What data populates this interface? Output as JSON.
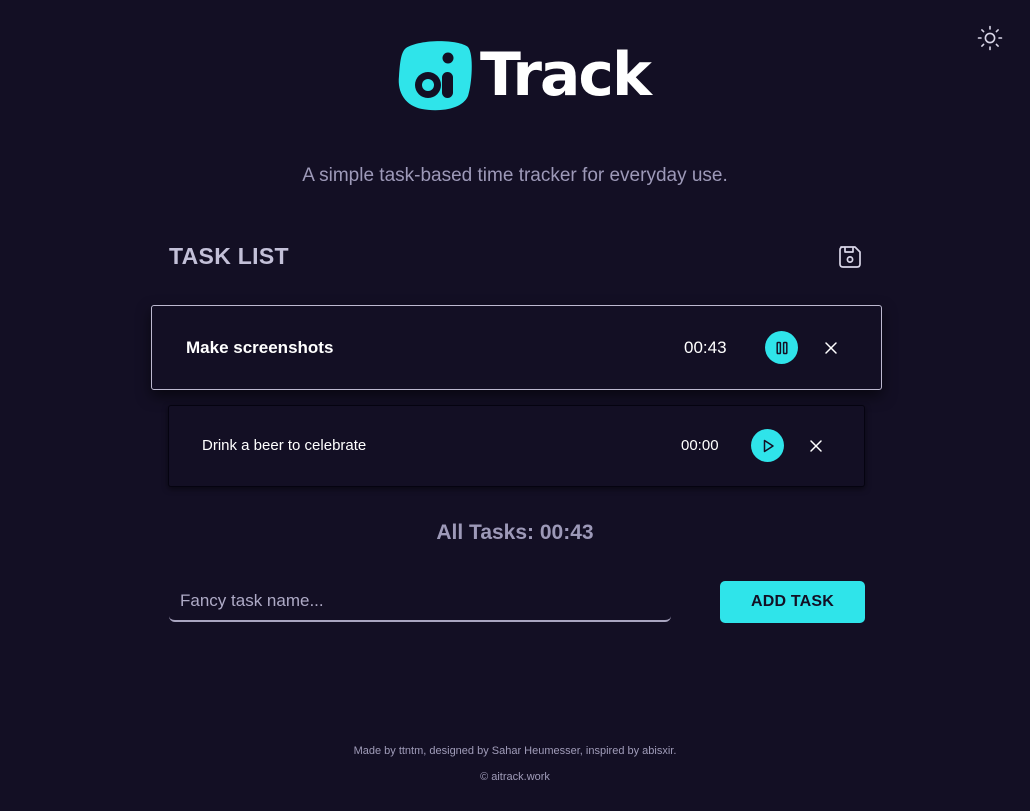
{
  "app": {
    "logo_text": "Track",
    "tagline": "A simple task-based time tracker for everyday use."
  },
  "icons": {
    "theme_toggle": "sun-icon",
    "save": "floppy-disk-icon",
    "pause": "pause-icon",
    "play": "play-icon",
    "delete": "close-icon"
  },
  "task_list": {
    "title": "TASK LIST",
    "tasks": [
      {
        "name": "Make screenshots",
        "time": "00:43",
        "status": "running"
      },
      {
        "name": "Drink a beer to celebrate",
        "time": "00:00",
        "status": "stopped"
      }
    ],
    "total": "All Tasks: 00:43"
  },
  "new_task": {
    "placeholder": "Fancy task name...",
    "value": "",
    "add_label": "ADD TASK"
  },
  "footer": {
    "credits": "Made by ttntm, designed by Sahar Heumesser, inspired by abisxir.",
    "copyright": "© aitrack.work"
  },
  "colors": {
    "background": "#130f24",
    "accent": "#2fe4ea",
    "muted_text": "#9d99b8"
  }
}
